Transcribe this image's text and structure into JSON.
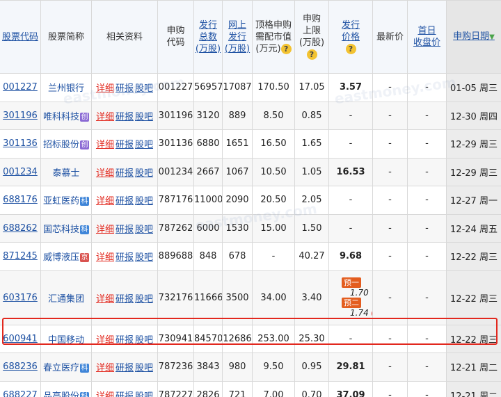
{
  "headers": {
    "stock_code": "股票代码",
    "stock_name": "股票简称",
    "related": "相关资料",
    "sub_code": "申购\n代码",
    "issue_total": "发行\n总数\n(万股)",
    "online_issue": "网上\n发行\n(万股)",
    "top_value": "顶格申购\n需配市值\n(万元)",
    "sub_limit": "申购\n上限\n(万股)",
    "issue_price": "发行\n价格",
    "latest_price": "最新价",
    "first_close": "首日\n收盘价",
    "sub_date": "申购日期"
  },
  "links": {
    "detail": "详细",
    "research": "研报",
    "bar": "股吧"
  },
  "badges": {
    "chuang": "创",
    "ke": "科",
    "jing": "京"
  },
  "pre_labels": {
    "first": "预一",
    "second": "预二"
  },
  "rows": [
    {
      "code": "001227",
      "name": "兰州银行",
      "badge": "",
      "sub_code": "001227",
      "total": "56957",
      "online": "17087",
      "top_value": "170.50",
      "limit": "17.05",
      "price": "3.57",
      "latest": "-",
      "first_close": "-",
      "date": "01-05 周三"
    },
    {
      "code": "301196",
      "name": "唯科科技",
      "badge": "创",
      "sub_code": "301196",
      "total": "3120",
      "online": "889",
      "top_value": "8.50",
      "limit": "0.85",
      "price": "-",
      "latest": "-",
      "first_close": "-",
      "date": "12-30 周四"
    },
    {
      "code": "301136",
      "name": "招标股份",
      "badge": "创",
      "sub_code": "301136",
      "total": "6880",
      "online": "1651",
      "top_value": "16.50",
      "limit": "1.65",
      "price": "-",
      "latest": "-",
      "first_close": "-",
      "date": "12-29 周三"
    },
    {
      "code": "001234",
      "name": "泰慕士",
      "badge": "",
      "sub_code": "001234",
      "total": "2667",
      "online": "1067",
      "top_value": "10.50",
      "limit": "1.05",
      "price": "16.53",
      "latest": "-",
      "first_close": "-",
      "date": "12-29 周三"
    },
    {
      "code": "688176",
      "name": "亚虹医药",
      "badge": "科",
      "sub_code": "787176",
      "total": "11000",
      "online": "2090",
      "top_value": "20.50",
      "limit": "2.05",
      "price": "-",
      "latest": "-",
      "first_close": "-",
      "date": "12-27 周一"
    },
    {
      "code": "688262",
      "name": "国芯科技",
      "badge": "科",
      "sub_code": "787262",
      "total": "6000",
      "online": "1530",
      "top_value": "15.00",
      "limit": "1.50",
      "price": "-",
      "latest": "-",
      "first_close": "-",
      "date": "12-24 周五"
    },
    {
      "code": "871245",
      "name": "威博液压",
      "badge": "京",
      "sub_code": "889688",
      "total": "848",
      "online": "678",
      "top_value": "-",
      "limit": "40.27",
      "price": "9.68",
      "latest": "-",
      "first_close": "-",
      "date": "12-22 周三"
    },
    {
      "code": "603176",
      "name": "汇通集团",
      "badge": "",
      "sub_code": "732176",
      "total": "11666",
      "online": "3500",
      "top_value": "34.00",
      "limit": "3.40",
      "price": "",
      "pre1": "1.70",
      "pre2": "1.74",
      "latest": "-",
      "first_close": "-",
      "date": "12-22 周三"
    },
    {
      "code": "600941",
      "name": "中国移动",
      "badge": "",
      "sub_code": "730941",
      "total": "84570",
      "online": "12686",
      "top_value": "253.00",
      "limit": "25.30",
      "price": "-",
      "latest": "-",
      "first_close": "-",
      "date": "12-22 周三"
    },
    {
      "code": "688236",
      "name": "春立医疗",
      "badge": "科",
      "sub_code": "787236",
      "total": "3843",
      "online": "980",
      "top_value": "9.50",
      "limit": "0.95",
      "price": "29.81",
      "latest": "-",
      "first_close": "-",
      "date": "12-21 周二"
    },
    {
      "code": "688227",
      "name": "品高股份",
      "badge": "科",
      "sub_code": "787227",
      "total": "2826",
      "online": "721",
      "top_value": "7.00",
      "limit": "0.70",
      "price": "37.09",
      "latest": "-",
      "first_close": "-",
      "date": "12-21 周二"
    }
  ],
  "colors": {
    "highlight": "#e2281e",
    "link": "#1f52a3",
    "detail": "#e2281e"
  }
}
